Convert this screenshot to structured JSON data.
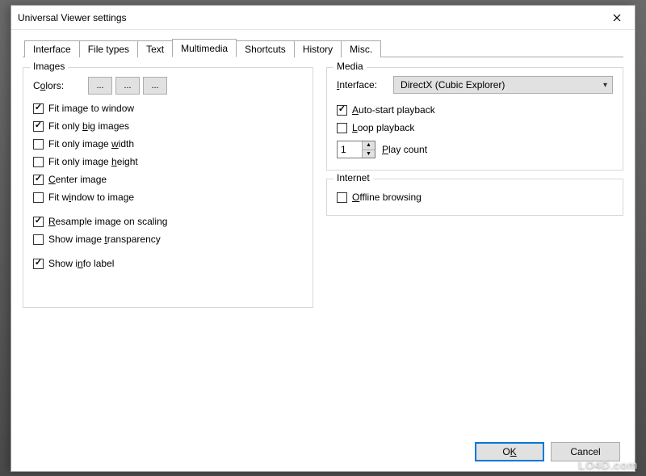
{
  "window": {
    "title": "Universal Viewer settings"
  },
  "tabs": {
    "interface": "Interface",
    "filetypes": "File types",
    "text": "Text",
    "multimedia": "Multimedia",
    "shortcuts": "Shortcuts",
    "history": "History",
    "misc": "Misc."
  },
  "images": {
    "title": "Images",
    "colors_pre": "C",
    "colors_u": "o",
    "colors_post": "lors:",
    "btn": "...",
    "fit_window": "Fit image to window",
    "fit_big_pre": "Fit only ",
    "fit_big_u": "b",
    "fit_big_post": "ig images",
    "fit_width_pre": "Fit only image ",
    "fit_width_u": "w",
    "fit_width_post": "idth",
    "fit_height_pre": "Fit only image ",
    "fit_height_u": "h",
    "fit_height_post": "eight",
    "center_u": "C",
    "center_post": "enter image",
    "fit_win_img_pre": "Fit w",
    "fit_win_img_u": "i",
    "fit_win_img_post": "ndow to image",
    "resample_u": "R",
    "resample_post": "esample image on scaling",
    "transparency_pre": "Show image ",
    "transparency_u": "t",
    "transparency_post": "ransparency",
    "info_pre": "Show i",
    "info_u": "n",
    "info_post": "fo label"
  },
  "media": {
    "title": "Media",
    "iface_u": "I",
    "iface_post": "nterface:",
    "iface_value": "DirectX (Cubic Explorer)",
    "auto_u": "A",
    "auto_post": "uto-start playback",
    "loop_u": "L",
    "loop_post": "oop playback",
    "playcount_val": "1",
    "playcount_u": "P",
    "playcount_post": "lay count"
  },
  "internet": {
    "title": "Internet",
    "offline_u": "O",
    "offline_post": "ffline browsing"
  },
  "footer": {
    "ok_pre": "O",
    "ok_u": "K",
    "cancel": "Cancel"
  },
  "watermark": "LO4D.com"
}
